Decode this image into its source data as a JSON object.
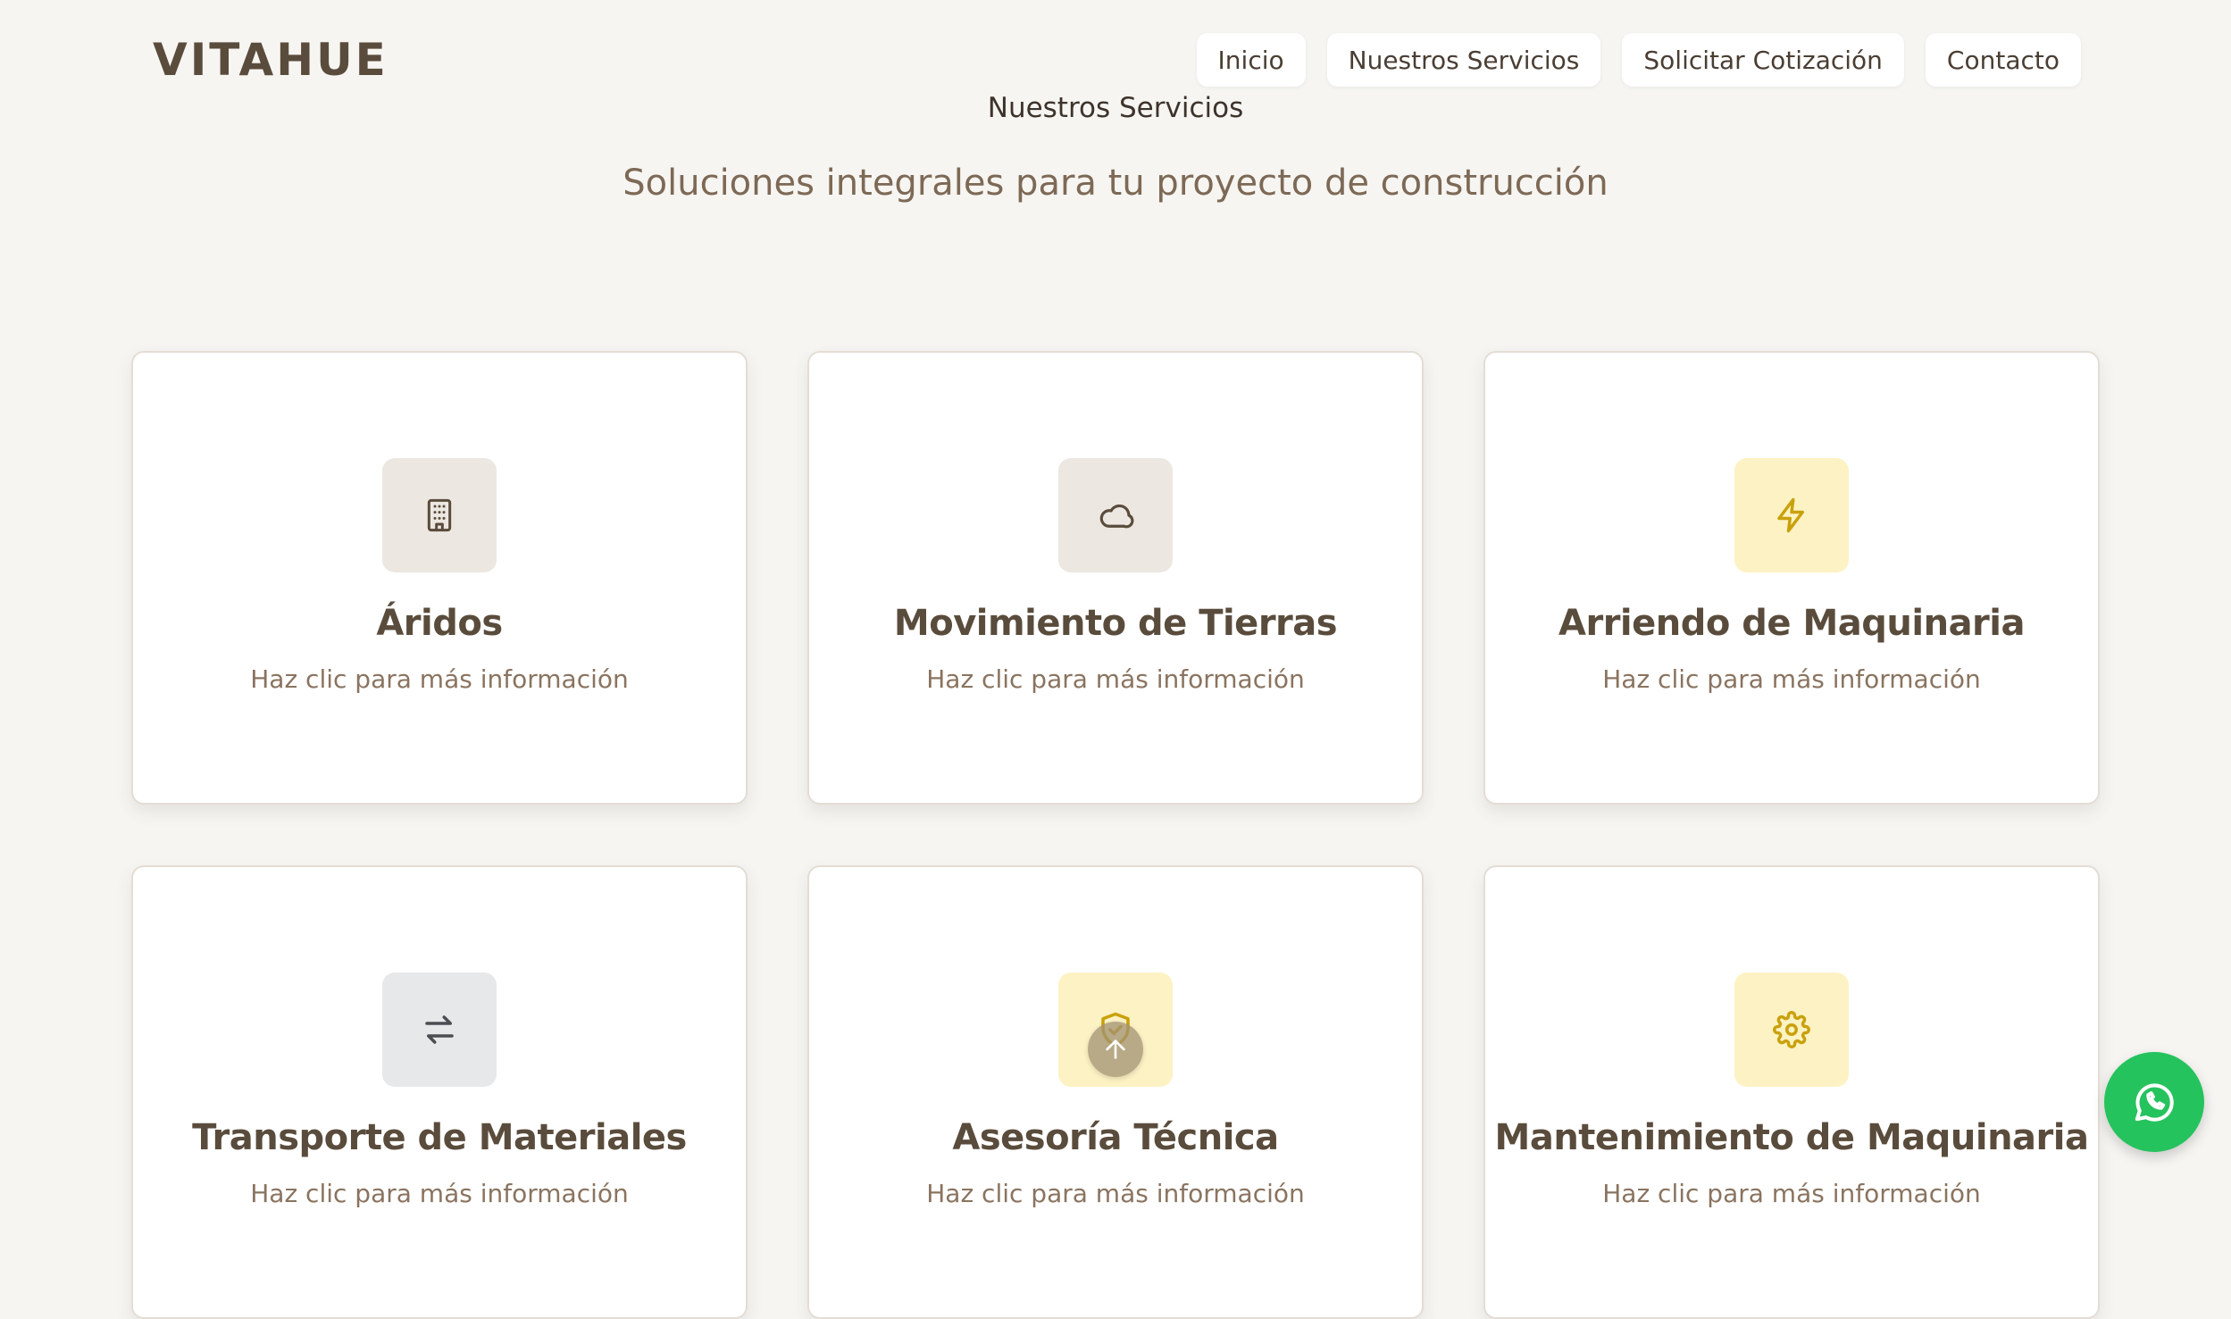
{
  "header": {
    "logo": "VITAHUE",
    "nav": [
      {
        "label": "Inicio"
      },
      {
        "label": "Nuestros Servicios"
      },
      {
        "label": "Solicitar Cotización"
      },
      {
        "label": "Contacto"
      }
    ]
  },
  "section": {
    "label": "Nuestros Servicios",
    "subtitle": "Soluciones integrales para tu proyecto de construcción"
  },
  "services": [
    {
      "title": "Áridos",
      "description": "Haz clic para más información",
      "icon": "building-icon",
      "icon_bg": "#ece7e1",
      "icon_color": "#5a4c3c"
    },
    {
      "title": "Movimiento de Tierras",
      "description": "Haz clic para más información",
      "icon": "cloud-icon",
      "icon_bg": "#ece7e1",
      "icon_color": "#5a4c3c"
    },
    {
      "title": "Arriendo de Maquinaria",
      "description": "Haz clic para más información",
      "icon": "lightning-icon",
      "icon_bg": "#fdf2c4",
      "icon_color": "#c9a10b"
    },
    {
      "title": "Transporte de Materiales",
      "description": "Haz clic para más información",
      "icon": "arrows-exchange-icon",
      "icon_bg": "#e6e8ea",
      "icon_color": "#4a4d52"
    },
    {
      "title": "Asesoría Técnica",
      "description": "Haz clic para más información",
      "icon": "shield-check-icon",
      "icon_bg": "#fdf2c4",
      "icon_color": "#c9a10b"
    },
    {
      "title": "Mantenimiento de Maquinaria",
      "description": "Haz clic para más información",
      "icon": "gear-icon",
      "icon_bg": "#fdf2c4",
      "icon_color": "#c9a10b"
    }
  ],
  "floating": {
    "scroll_top_icon": "arrow-up-icon",
    "whatsapp_icon": "whatsapp-icon",
    "whatsapp_color": "#25c35e"
  }
}
